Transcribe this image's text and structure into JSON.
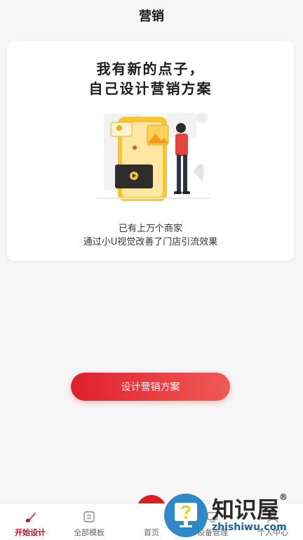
{
  "header": {
    "title": "营销"
  },
  "card": {
    "headline_line1": "我有新的点子，",
    "headline_line2": "自己设计营销方案",
    "subtitle_line1": "已有上万个商家",
    "subtitle_line2": "通过小U视觉改善了门店引流效果"
  },
  "cta": {
    "label": "设计营销方案"
  },
  "tabbar": {
    "items": [
      {
        "label": "开始设计",
        "icon": "brush-icon",
        "active": true
      },
      {
        "label": "全部模板",
        "icon": "template-icon",
        "active": false
      },
      {
        "label": "首页",
        "icon": "home-icon",
        "active": false
      },
      {
        "label": "设备管理",
        "icon": "device-icon",
        "active": false
      },
      {
        "label": "个人中心",
        "icon": "user-icon",
        "active": false
      }
    ]
  },
  "watermark": {
    "brand": "知识屋",
    "reg": "®",
    "url": "zhishiwu.com"
  },
  "colors": {
    "accent": "#d71e28",
    "gradient_end": "#ef5a55",
    "bg": "#f6f6f6"
  }
}
